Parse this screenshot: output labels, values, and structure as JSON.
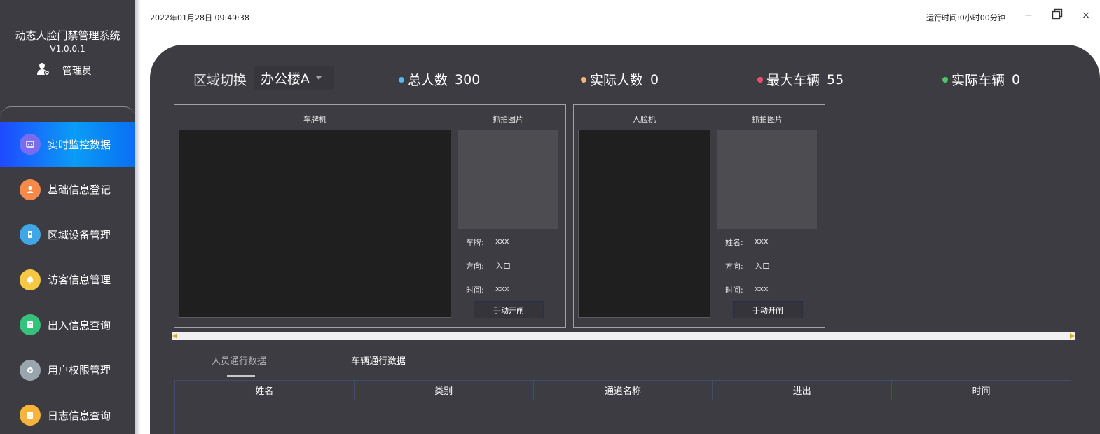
{
  "app": {
    "title": "动态人脸门禁管理系统",
    "version": "V1.0.0.1",
    "user_role": "管理员"
  },
  "titlebar": {
    "datetime": "2022年01月28日 09:49:38",
    "runtime": "运行时间:0小时00分钟",
    "minimize_glyph": "−",
    "maximize_glyph": "❐",
    "close_glyph": "×"
  },
  "sidebar": {
    "active_index": 0,
    "items": [
      {
        "label": "实时监控数据",
        "icon": "monitor-icon",
        "color": "#7a6cf0"
      },
      {
        "label": "基础信息登记",
        "icon": "user-icon",
        "color": "#f58a4b"
      },
      {
        "label": "区域设备管理",
        "icon": "device-icon",
        "color": "#3fa6e8"
      },
      {
        "label": "访客信息管理",
        "icon": "bell-icon",
        "color": "#f7c843"
      },
      {
        "label": "出入信息查询",
        "icon": "record-icon",
        "color": "#35c27a"
      },
      {
        "label": "用户权限管理",
        "icon": "gear-icon",
        "color": "#9aa6ad"
      },
      {
        "label": "日志信息查询",
        "icon": "log-icon",
        "color": "#f7b33c"
      }
    ]
  },
  "header": {
    "zone_label": "区域切换",
    "zone_selected": "办公楼A",
    "stats": [
      {
        "label": "总人数",
        "value": "300",
        "color": "#5bb8e6"
      },
      {
        "label": "实际人数",
        "value": "0",
        "color": "#f3b57a"
      },
      {
        "label": "最大车辆",
        "value": "55",
        "color": "#f0506a"
      },
      {
        "label": "实际车辆",
        "value": "0",
        "color": "#4cc46a"
      }
    ]
  },
  "plate_panel": {
    "camera_title": "车牌机",
    "snapshot_title": "抓拍图片",
    "rows": [
      {
        "key": "车牌:",
        "value": "xxx"
      },
      {
        "key": "方向:",
        "value": "入口"
      },
      {
        "key": "时间:",
        "value": "xxx"
      }
    ],
    "button": "手动开闸"
  },
  "face_panel": {
    "camera_title": "人脸机",
    "snapshot_title": "抓拍图片",
    "rows": [
      {
        "key": "姓名:",
        "value": "xxx"
      },
      {
        "key": "方向:",
        "value": "入口"
      },
      {
        "key": "时间:",
        "value": "xxx"
      }
    ],
    "button": "手动开闸"
  },
  "tabs": [
    {
      "label": "人员通行数据",
      "active": true
    },
    {
      "label": "车辆通行数据",
      "active": false
    }
  ],
  "table": {
    "columns": [
      "姓名",
      "类别",
      "通道名称",
      "进出",
      "时间"
    ]
  }
}
